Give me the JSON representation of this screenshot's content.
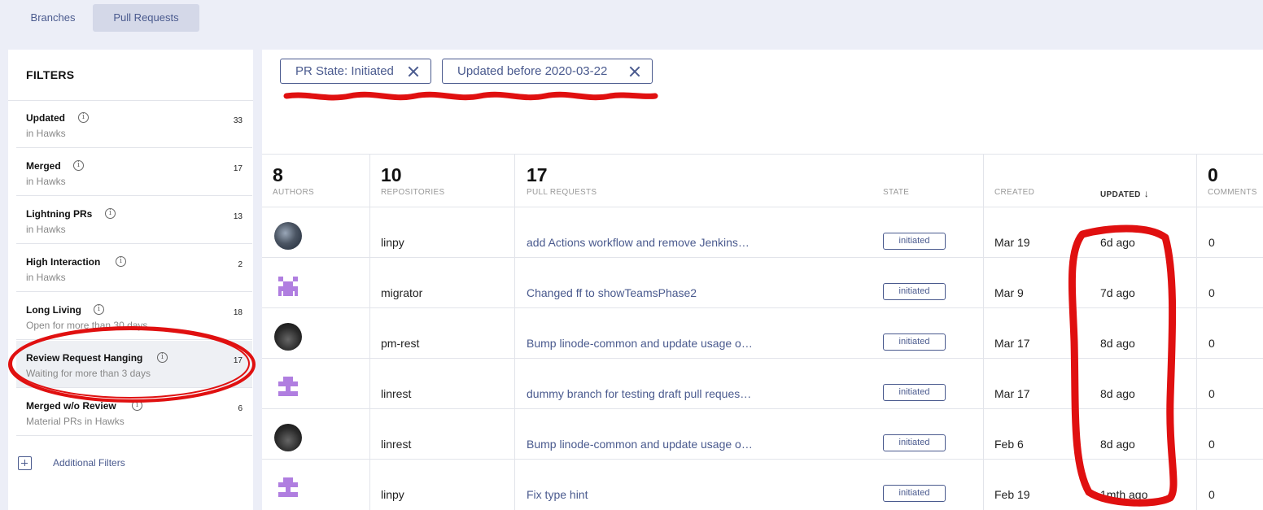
{
  "tabs": [
    {
      "label": "Branches"
    },
    {
      "label": "Pull Requests"
    }
  ],
  "sidebar": {
    "title": "FILTERS",
    "filters": [
      {
        "name": "Updated",
        "sub": "in Hawks",
        "count": "33"
      },
      {
        "name": "Merged",
        "sub": "in Hawks",
        "count": "17"
      },
      {
        "name": "Lightning PRs",
        "sub": "in Hawks",
        "count": "13"
      },
      {
        "name": "High Interaction",
        "sub": "in Hawks",
        "count": "2"
      },
      {
        "name": "Long Living",
        "sub": "Open for more than 30 days",
        "count": "18"
      },
      {
        "name": "Review Request Hanging",
        "sub": "Waiting for more than 3 days",
        "count": "17"
      },
      {
        "name": "Merged w/o Review",
        "sub": "Material PRs in Hawks",
        "count": "6"
      }
    ],
    "additional_filters": "Additional Filters"
  },
  "active_filters": [
    {
      "label": "PR State: Initiated"
    },
    {
      "label": "Updated before 2020-03-22"
    }
  ],
  "table": {
    "header": {
      "authors_count": "8",
      "authors_label": "AUTHORS",
      "repos_count": "10",
      "repos_label": "REPOSITORIES",
      "prs_count": "17",
      "prs_label": "PULL REQUESTS",
      "state_label": "STATE",
      "created_label": "CREATED",
      "updated_label": "UPDATED",
      "comments_count": "0",
      "comments_label": "COMMENTS"
    },
    "rows": [
      {
        "avatar": "photo-avatar",
        "repo": "linpy",
        "title": "add Actions workflow and remove Jenkins…",
        "state": "initiated",
        "created": "Mar 19",
        "updated": "6d ago",
        "comments": "0"
      },
      {
        "avatar": "purple-pixel-avatar",
        "repo": "migrator",
        "title": "Changed ff to showTeamsPhase2",
        "state": "initiated",
        "created": "Mar 9",
        "updated": "7d ago",
        "comments": "0"
      },
      {
        "avatar": "dark-photo-avatar",
        "repo": "pm-rest",
        "title": "Bump linode-common and update usage o…",
        "state": "initiated",
        "created": "Mar 17",
        "updated": "8d ago",
        "comments": "0"
      },
      {
        "avatar": "purple-pixel-avatar",
        "repo": "linrest",
        "title": "dummy branch for testing draft pull reques…",
        "state": "initiated",
        "created": "Mar 17",
        "updated": "8d ago",
        "comments": "0"
      },
      {
        "avatar": "dark-photo-avatar",
        "repo": "linrest",
        "title": "Bump linode-common and update usage o…",
        "state": "initiated",
        "created": "Feb 6",
        "updated": "8d ago",
        "comments": "0"
      },
      {
        "avatar": "purple-pixel-avatar",
        "repo": "linpy",
        "title": "Fix type hint",
        "state": "initiated",
        "created": "Feb 19",
        "updated": "1mth ago",
        "comments": "0"
      }
    ]
  },
  "colors": {
    "accent": "#4a5a8e",
    "annotation": "#e01010"
  }
}
